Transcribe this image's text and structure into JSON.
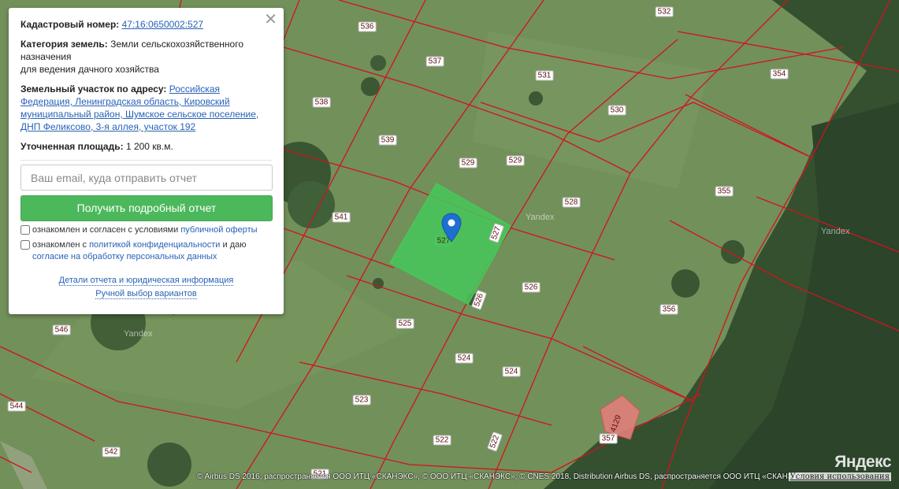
{
  "card": {
    "cadastral_label": "Кадастровый номер:",
    "cadastral_value": "47:16:0650002:527",
    "category_label": "Категория земель:",
    "category_value": "Земли сельскохозяйственного назначения",
    "category_sub": "для ведения дачного хозяйства",
    "address_label": "Земельный участок по адресу:",
    "address_value": "Российская Федерация, Ленинградская область, Кировский муниципальный район, Шумское сельское поселение, ДНП Феликсово, 3-я аллея, участок 192",
    "area_label": "Уточненная площадь:",
    "area_value": "1 200 кв.м.",
    "email_placeholder": "Ваш email, куда отправить отчет",
    "get_report_button": "Получить подробный отчет",
    "agree_prefix": "ознакомлен и согласен с условиями",
    "agree_link": "публичной оферты",
    "privacy_prefix": "ознакомлен с",
    "privacy_link": "политикой конфиденциальности",
    "privacy_mid": "и даю",
    "consent_link": "согласие на обработку персональных данных",
    "details_link": "Детали отчета и юридическая информация",
    "manual_link": "Ручной выбор вариантов",
    "close_icon": "close-icon"
  },
  "map": {
    "selected_parcel": "527",
    "parcel_labels": [
      "536",
      "537",
      "538",
      "539",
      "541",
      "546",
      "544",
      "542",
      "532",
      "531",
      "530",
      "529",
      "529",
      "528",
      "527",
      "527",
      "526",
      "526",
      "525",
      "524",
      "524",
      "523",
      "522",
      "522",
      "521",
      "357",
      "4129",
      "354",
      "355",
      "356"
    ],
    "watermarks": [
      "Yandex",
      "Yandex",
      "Yandex"
    ],
    "logo": "Яндекс",
    "copyright": "© Airbus DS 2016, распространяется ООО ИТЦ «СКАНЭКС», © ООО ИТЦ «СКАНЭКС», © CNES 2018, Distribution Airbus DS, распространяется ООО ИТЦ «СКАНЭКС»",
    "terms_link": "Условия использования",
    "colors": {
      "boundary": "#d0141e",
      "selected_fill": "#46c85a",
      "forest": "#2f4a2c",
      "field": "#6f8e58"
    },
    "pin_icon": "map-pin-icon"
  }
}
